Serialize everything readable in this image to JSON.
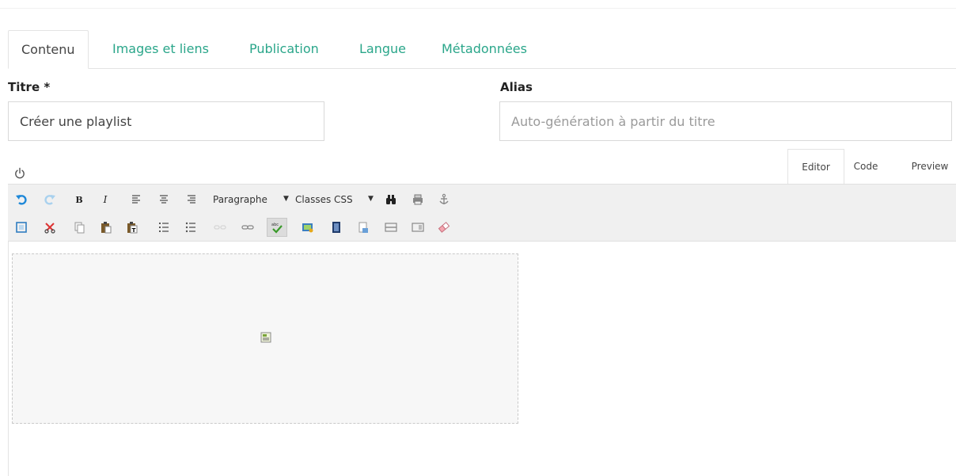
{
  "tabs": [
    {
      "label": "Contenu",
      "active": true
    },
    {
      "label": "Images et liens"
    },
    {
      "label": "Publication"
    },
    {
      "label": "Langue"
    },
    {
      "label": "Métadonnées"
    }
  ],
  "form": {
    "title_label": "Titre *",
    "title_value": "Créer une playlist",
    "alias_label": "Alias",
    "alias_placeholder": "Auto-génération à partir du titre"
  },
  "editor": {
    "tabs": [
      {
        "label": "Editor",
        "active": true
      },
      {
        "label": "Code"
      },
      {
        "label": "Preview"
      }
    ],
    "format_select": "Paragraphe",
    "classes_select": "Classes CSS",
    "bold_label": "B",
    "italic_label": "I"
  },
  "colors": {
    "accent": "#2aa68a",
    "toolbar_bg": "#f0f0f0",
    "border": "#e3e3e3"
  }
}
